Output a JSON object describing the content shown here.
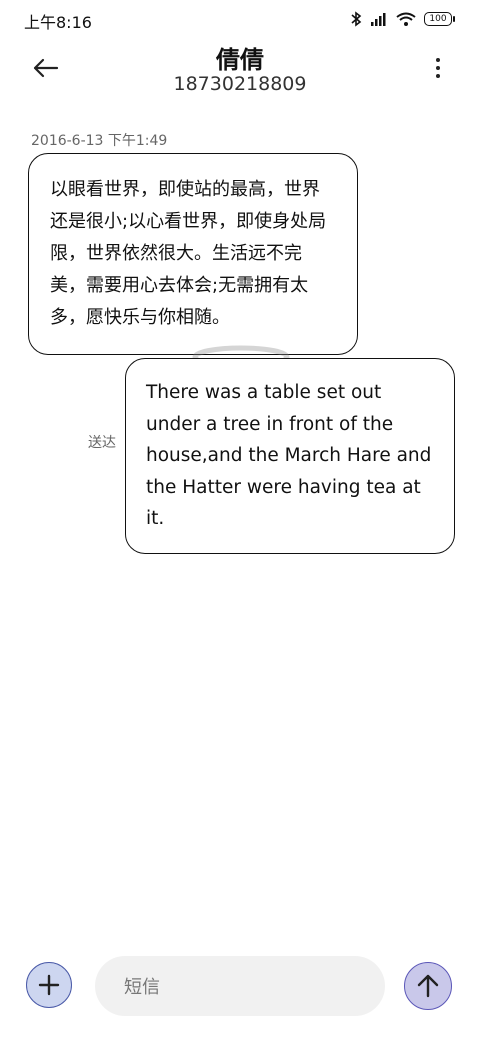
{
  "status_bar": {
    "time": "上午8:16",
    "battery": "100"
  },
  "header": {
    "contact_name": "倩倩",
    "contact_number": "18730218809"
  },
  "messages": [
    {
      "timestamp": "2016-6-13 下午1:49",
      "direction": "incoming",
      "text": "以眼看世界，即使站的最高，世界还是很小;以心看世界，即使身处局限，世界依然很大。生活远不完美，需要用心去体会;无需拥有太多，愿快乐与你相随。"
    },
    {
      "direction": "outgoing",
      "status": "送达",
      "text": "There was a table set out under a tree in front of the house,and the March Hare and the Hatter were having tea at it."
    }
  ],
  "compose": {
    "placeholder": "短信"
  },
  "colors": {
    "add_button_bg": "#cdd6f0",
    "send_button_bg": "#c9c8ea",
    "input_bg": "#f1f1f1"
  }
}
